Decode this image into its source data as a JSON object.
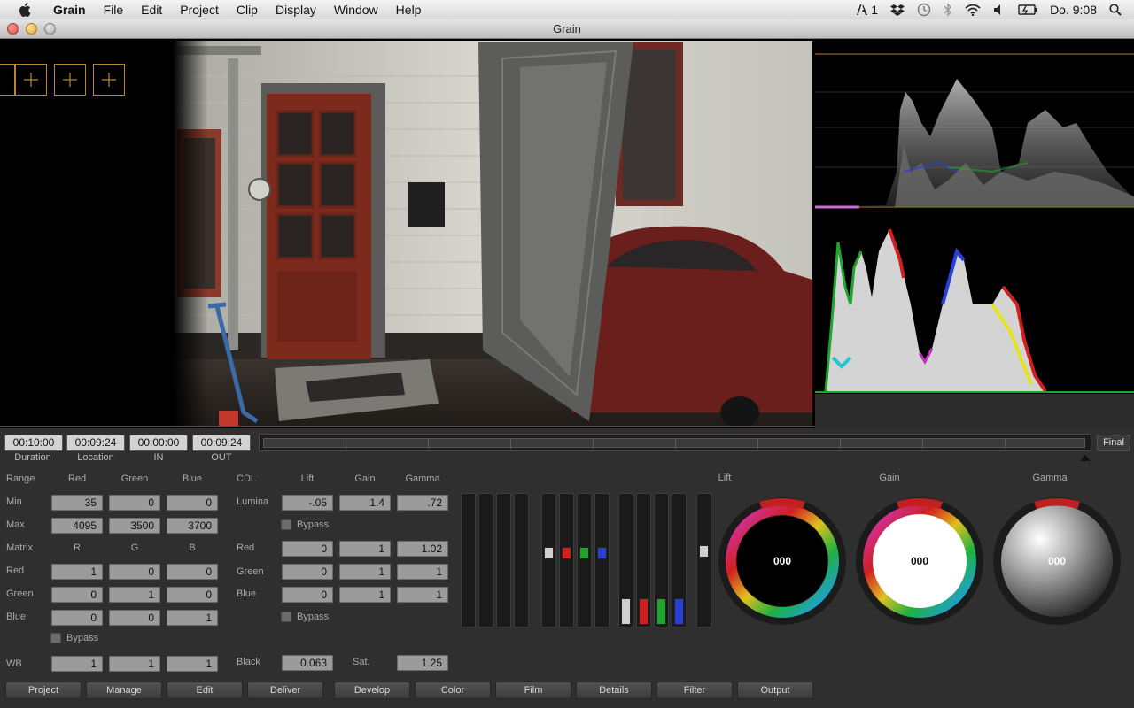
{
  "menubar": {
    "app": "Grain",
    "items": [
      "File",
      "Edit",
      "Project",
      "Clip",
      "Display",
      "Window",
      "Help"
    ],
    "status": {
      "adobe_count": "1",
      "clock": "Do. 9:08"
    }
  },
  "window": {
    "title": "Grain"
  },
  "timecodes": [
    {
      "value": "00:10:00",
      "label": "Duration"
    },
    {
      "value": "00:09:24",
      "label": "Location"
    },
    {
      "value": "00:00:00",
      "label": "IN"
    },
    {
      "value": "00:09:24",
      "label": "OUT"
    }
  ],
  "timeline": {
    "final_label": "Final"
  },
  "range": {
    "header": "Range",
    "columns": [
      "Red",
      "Green",
      "Blue"
    ],
    "min_label": "Min",
    "max_label": "Max",
    "min": [
      "35",
      "0",
      "0"
    ],
    "max": [
      "4095",
      "3500",
      "3700"
    ]
  },
  "matrix": {
    "header": "Matrix",
    "columns": [
      "R",
      "G",
      "B"
    ],
    "rows": [
      {
        "label": "Red",
        "values": [
          "1",
          "0",
          "0"
        ]
      },
      {
        "label": "Green",
        "values": [
          "0",
          "1",
          "0"
        ]
      },
      {
        "label": "Blue",
        "values": [
          "0",
          "0",
          "1"
        ]
      }
    ],
    "bypass_label": "Bypass"
  },
  "wb": {
    "label": "WB",
    "values": [
      "1",
      "1",
      "1"
    ]
  },
  "cdl": {
    "header": "CDL",
    "columns": [
      "Lift",
      "Gain",
      "Gamma"
    ],
    "lumina_label": "Lumina",
    "lumina": [
      "-.05",
      "1.4",
      ".72"
    ],
    "bypass_label_1": "Bypass",
    "rows": [
      {
        "label": "Red",
        "values": [
          "0",
          "1",
          "1.02"
        ]
      },
      {
        "label": "Green",
        "values": [
          "0",
          "1",
          "1"
        ]
      },
      {
        "label": "Blue",
        "values": [
          "0",
          "1",
          "1"
        ]
      }
    ],
    "bypass_label_2": "Bypass",
    "black_label": "Black",
    "black": "0.063",
    "sat_label": "Sat.",
    "sat": "1.25"
  },
  "wheels": [
    {
      "title": "Lift",
      "value": "000"
    },
    {
      "title": "Gain",
      "value": "000"
    },
    {
      "title": "Gamma",
      "value": "000"
    }
  ],
  "tabs": [
    "Project",
    "Manage",
    "Edit",
    "Deliver",
    "Develop",
    "Color",
    "Film",
    "Details",
    "Filter",
    "Output"
  ],
  "colors": {
    "red": "#d01f1f",
    "green": "#1fa52e",
    "blue": "#2a3fd6",
    "marker": "#b8862b"
  }
}
